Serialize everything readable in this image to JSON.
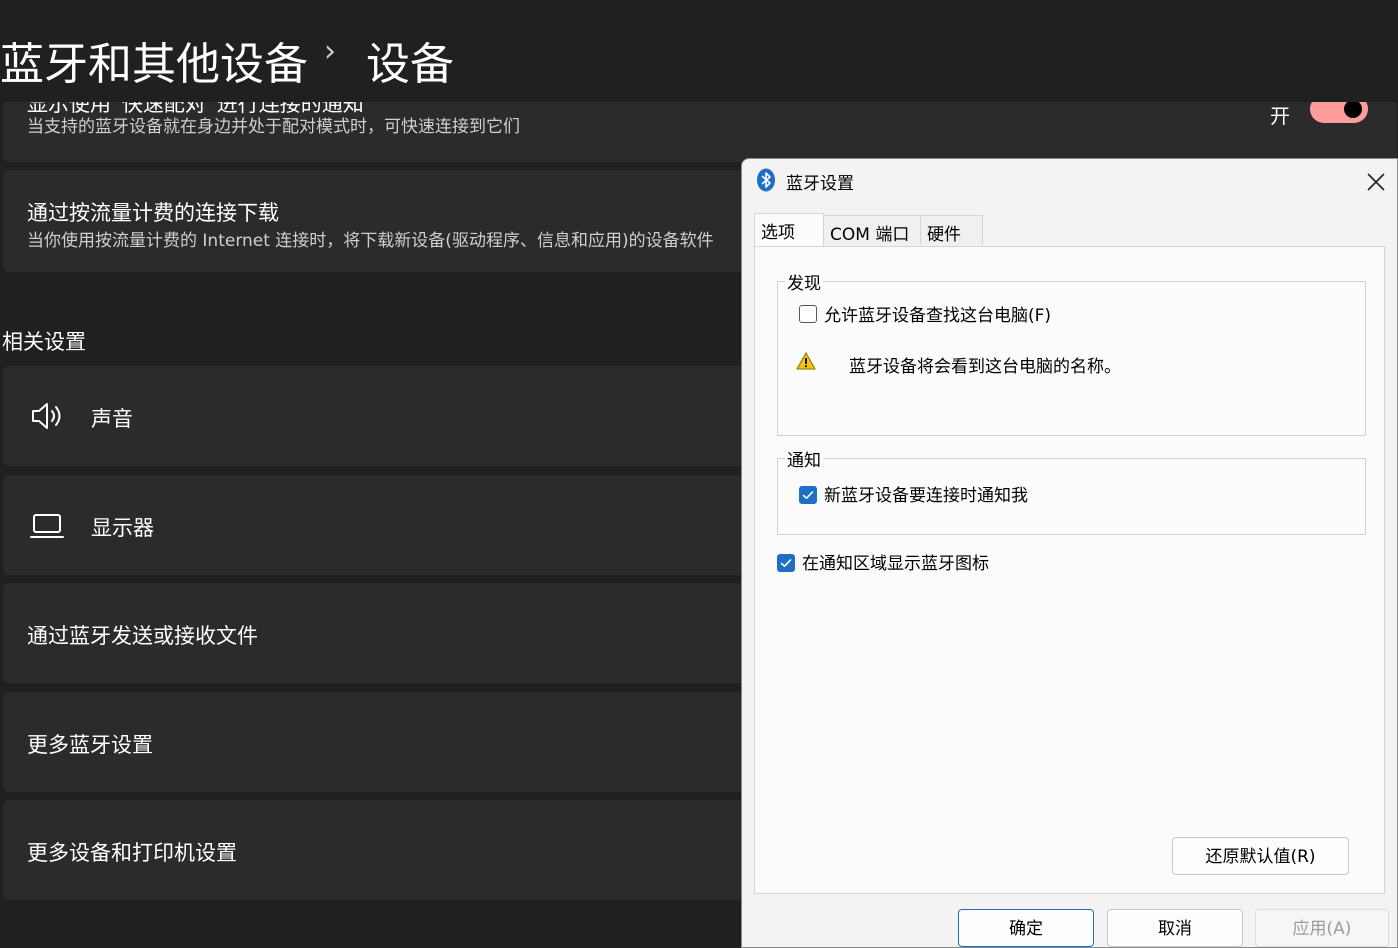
{
  "breadcrumb": {
    "parent": "蓝牙和其他设备",
    "separator": "›",
    "current": "设备"
  },
  "cards": {
    "swift_pair": {
      "title": "显示使用“快速配对”进行连接的通知",
      "subtitle": "当支持的蓝牙设备就在身边并处于配对模式时，可快速连接到它们",
      "toggle_label": "开",
      "toggle_on": true,
      "toggle_color": "#ff9c9c"
    },
    "metered": {
      "title": "通过按流量计费的连接下载",
      "subtitle": "当你使用按流量计费的 Internet 连接时，将下载新设备(驱动程序、信息和应用)的设备软件"
    }
  },
  "related": {
    "heading": "相关设置",
    "items": [
      {
        "label": "声音",
        "icon": "speaker-icon"
      },
      {
        "label": "显示器",
        "icon": "laptop-icon"
      },
      {
        "label": "通过蓝牙发送或接收文件"
      },
      {
        "label": "更多蓝牙设置"
      },
      {
        "label": "更多设备和打印机设置"
      }
    ]
  },
  "dialog": {
    "title": "蓝牙设置",
    "icon": "bluetooth-icon",
    "tabs": [
      "选项",
      "COM 端口",
      "硬件"
    ],
    "active_tab": 0,
    "discovery": {
      "label": "发现",
      "allow_find": {
        "label": "允许蓝牙设备查找这台电脑(F)",
        "checked": false
      },
      "warning": "蓝牙设备将会看到这台电脑的名称。"
    },
    "notifications": {
      "label": "通知",
      "notify_new": {
        "label": "新蓝牙设备要连接时通知我",
        "checked": true
      }
    },
    "show_icon": {
      "label": "在通知区域显示蓝牙图标",
      "checked": true
    },
    "restore_defaults": "还原默认值(R)",
    "ok": "确定",
    "cancel": "取消",
    "apply": "应用(A)"
  },
  "colors": {
    "background": "#202020",
    "card": "#2b2b2b",
    "accent": "#1f6fc5"
  }
}
